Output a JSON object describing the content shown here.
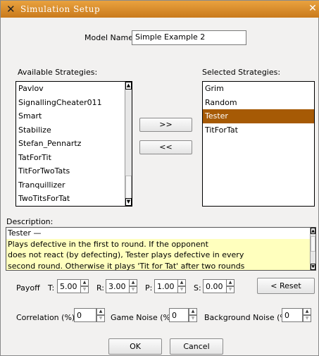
{
  "window": {
    "title": "Simulation Setup"
  },
  "model": {
    "label": "Model Name",
    "value": "Simple Example 2"
  },
  "available": {
    "label": "Available Strategies:",
    "items": [
      "Pavlov",
      "SignallingCheater011",
      "Smart",
      "Stabilize",
      "Stefan_Pennartz",
      "TatForTit",
      "TitForTwoTats",
      "Tranquillizer",
      "TwoTitsForTat"
    ]
  },
  "transfer": {
    "add": ">>",
    "remove": "<<"
  },
  "selected": {
    "label": "Selected Strategies:",
    "items": [
      "Grim",
      "Random",
      "Tester",
      "TitForTat"
    ],
    "selected_item": "Tester"
  },
  "description": {
    "label": "Description:",
    "lines": [
      "Tester —",
      "Plays defective in the first to round. If the opponent",
      "does not react (by defecting), Tester plays defective in every",
      "second round. Otherwise it plays 'Tit for Tat' after two rounds"
    ]
  },
  "payoff": {
    "label": "Payoff",
    "T": {
      "label": "T:",
      "value": "5.00"
    },
    "R": {
      "label": "R:",
      "value": "3.00"
    },
    "P": {
      "label": "P:",
      "value": "1.00"
    },
    "S": {
      "label": "S:",
      "value": "0.00"
    },
    "reset": "< Reset"
  },
  "noise": {
    "correlation": {
      "label": "Correlation (%)",
      "value": "0"
    },
    "game": {
      "label": "Game Noise (%)",
      "value": "0"
    },
    "background": {
      "label": "Background Noise (%)",
      "value": "0"
    }
  },
  "buttons": {
    "ok": "OK",
    "cancel": "Cancel"
  },
  "colors": {
    "titlebar": "#d98a2b",
    "selection": "#a65a05",
    "highlight": "#ffffbe"
  }
}
